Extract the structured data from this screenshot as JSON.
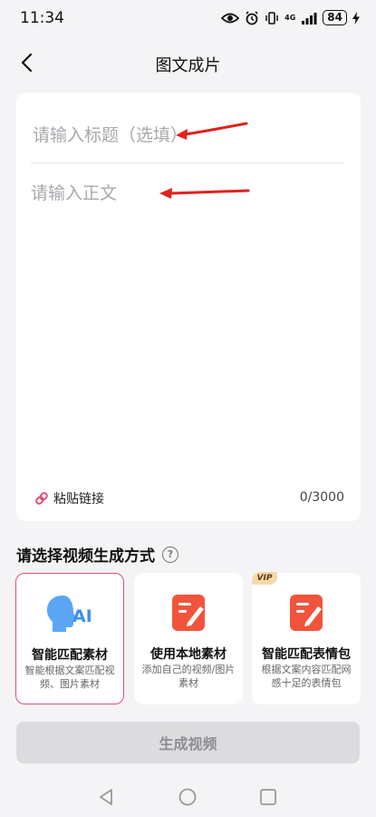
{
  "status_bar": {
    "time": "11:34",
    "network": "4G",
    "battery": "84"
  },
  "header": {
    "title": "图文成片"
  },
  "editor": {
    "title_placeholder": "请输入标题（选填）",
    "body_placeholder": "请输入正文",
    "paste_label": "粘贴链接",
    "char_count": "0/3000"
  },
  "section": {
    "title": "请选择视频生成方式"
  },
  "options": [
    {
      "title": "智能匹配素材",
      "desc": "智能根据文案匹配视频、图片素材",
      "icon_label": "AI",
      "selected": true
    },
    {
      "title": "使用本地素材",
      "desc": "添加自己的视频/图片素材",
      "selected": false
    },
    {
      "title": "智能匹配表情包",
      "desc": "根据文案内容匹配网感十足的表情包",
      "badge": "VIP",
      "selected": false
    }
  ],
  "generate_button": {
    "label": "生成视频"
  },
  "colors": {
    "background": "#f4f4f6",
    "selected_border": "#e14f73",
    "accent_orange": "#f0553c",
    "ai_blue": "#3d8ef0",
    "button_disabled": "#dcdcde",
    "annotation_red": "#e0211d"
  }
}
